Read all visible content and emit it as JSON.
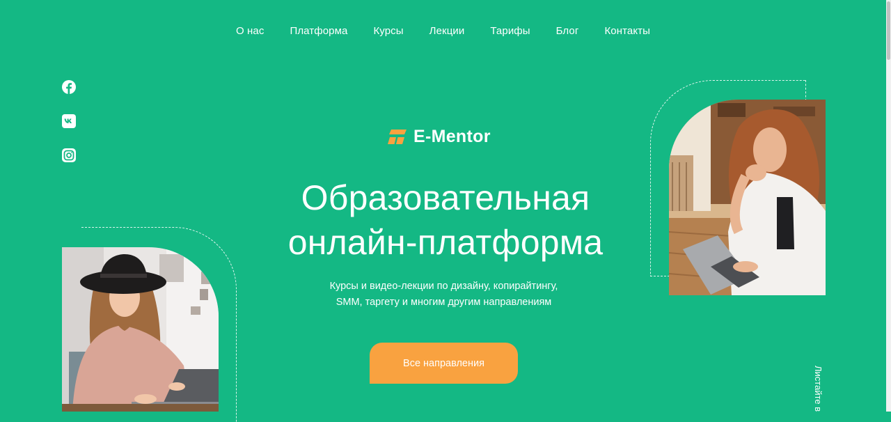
{
  "nav": {
    "items": [
      "О нас",
      "Платформа",
      "Курсы",
      "Лекции",
      "Тарифы",
      "Блог",
      "Контакты"
    ]
  },
  "social": {
    "icons": [
      "facebook-icon",
      "vk-icon",
      "instagram-icon"
    ]
  },
  "logo": {
    "text": "E-Mentor",
    "icon": "e-mentor-logo-icon",
    "icon_color": "#f9a240"
  },
  "hero": {
    "title_line1": "Образовательная",
    "title_line2": "онлайн-платформа",
    "subtitle_line1": "Курсы и видео-лекции по дизайну, копирайтингу,",
    "subtitle_line2": "SMM, таргету и многим другим направлениям",
    "cta_label": "Все направления"
  },
  "scroll_hint": "Листайте в",
  "colors": {
    "background": "#14b884",
    "accent": "#f9a240",
    "text": "#ffffff"
  }
}
